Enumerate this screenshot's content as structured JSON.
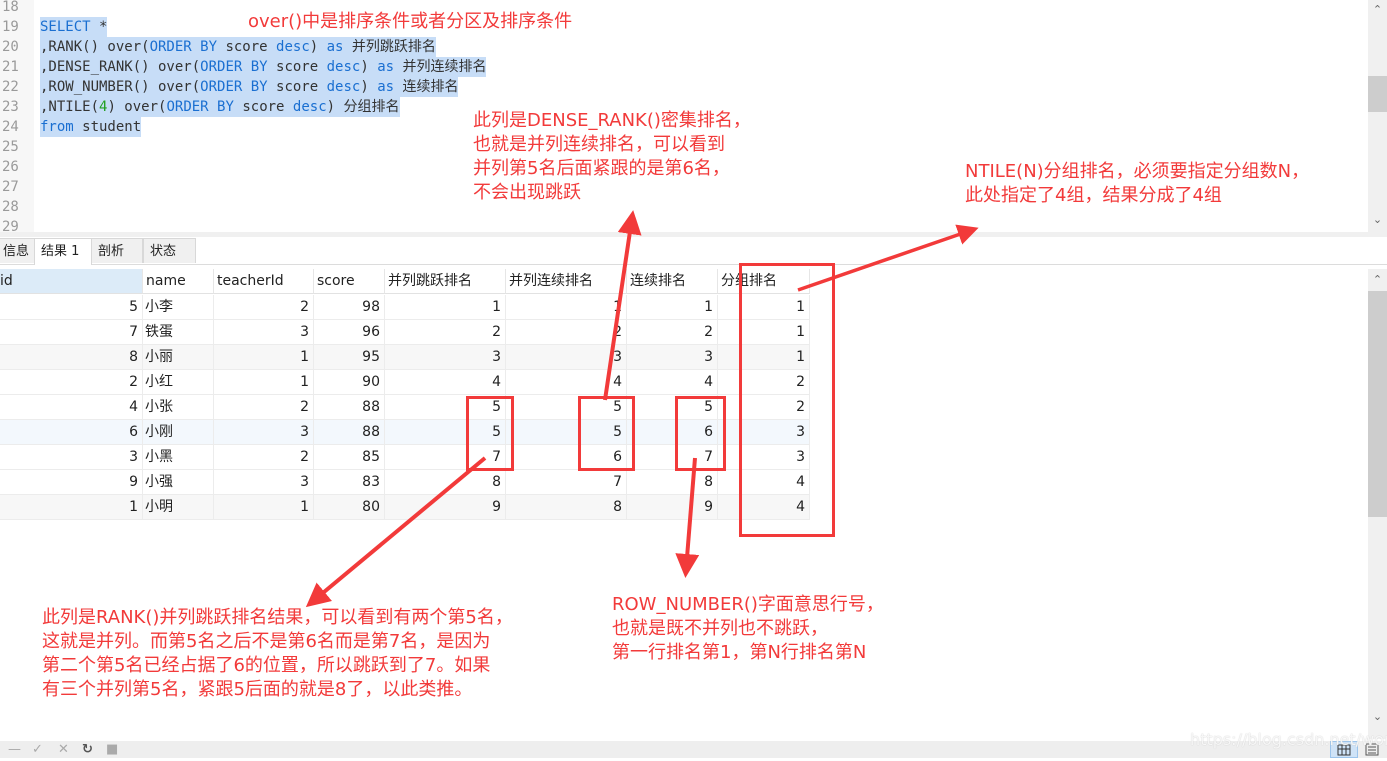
{
  "editor": {
    "lines": [
      {
        "n": "18",
        "tokens": []
      },
      {
        "n": "19",
        "tokens": [
          {
            "t": "SELECT",
            "c": "kw"
          },
          {
            "t": " *",
            "c": ""
          }
        ]
      },
      {
        "n": "20",
        "tokens": [
          {
            "t": ",RANK() over(",
            "c": ""
          },
          {
            "t": "ORDER BY",
            "c": "kw"
          },
          {
            "t": " score ",
            "c": ""
          },
          {
            "t": "desc",
            "c": "kw"
          },
          {
            "t": ") ",
            "c": ""
          },
          {
            "t": "as",
            "c": "kw"
          },
          {
            "t": " 并列跳跃排名",
            "c": ""
          }
        ]
      },
      {
        "n": "21",
        "tokens": [
          {
            "t": ",DENSE_RANK() over(",
            "c": ""
          },
          {
            "t": "ORDER BY",
            "c": "kw"
          },
          {
            "t": " score ",
            "c": ""
          },
          {
            "t": "desc",
            "c": "kw"
          },
          {
            "t": ") ",
            "c": ""
          },
          {
            "t": "as",
            "c": "kw"
          },
          {
            "t": " 并列连续排名",
            "c": ""
          }
        ]
      },
      {
        "n": "22",
        "tokens": [
          {
            "t": ",ROW_NUMBER() over(",
            "c": ""
          },
          {
            "t": "ORDER BY",
            "c": "kw"
          },
          {
            "t": " score ",
            "c": ""
          },
          {
            "t": "desc",
            "c": "kw"
          },
          {
            "t": ") ",
            "c": ""
          },
          {
            "t": "as",
            "c": "kw"
          },
          {
            "t": " 连续排名",
            "c": ""
          }
        ]
      },
      {
        "n": "23",
        "tokens": [
          {
            "t": ",NTILE(",
            "c": ""
          },
          {
            "t": "4",
            "c": "num"
          },
          {
            "t": ") over(",
            "c": ""
          },
          {
            "t": "ORDER BY",
            "c": "kw"
          },
          {
            "t": " score ",
            "c": ""
          },
          {
            "t": "desc",
            "c": "kw"
          },
          {
            "t": ") 分组排名",
            "c": ""
          }
        ]
      },
      {
        "n": "24",
        "tokens": [
          {
            "t": "from",
            "c": "kw"
          },
          {
            "t": " student",
            "c": ""
          }
        ]
      },
      {
        "n": "25",
        "tokens": []
      },
      {
        "n": "26",
        "tokens": []
      },
      {
        "n": "27",
        "tokens": []
      },
      {
        "n": "28",
        "tokens": []
      },
      {
        "n": "29",
        "tokens": []
      }
    ]
  },
  "tabs": [
    {
      "label": "信息",
      "active": false
    },
    {
      "label": "结果 1",
      "active": true
    },
    {
      "label": "剖析",
      "active": false
    },
    {
      "label": "状态",
      "active": false
    }
  ],
  "grid": {
    "columns": [
      "id",
      "name",
      "teacherId",
      "score",
      "并列跳跃排名",
      "并列连续排名",
      "连续排名",
      "分组排名"
    ],
    "rows": [
      [
        "5",
        "小李",
        "2",
        "98",
        "1",
        "1",
        "1",
        "1"
      ],
      [
        "7",
        "铁蛋",
        "3",
        "96",
        "2",
        "2",
        "2",
        "1"
      ],
      [
        "8",
        "小丽",
        "1",
        "95",
        "3",
        "3",
        "3",
        "1"
      ],
      [
        "2",
        "小红",
        "1",
        "90",
        "4",
        "4",
        "4",
        "2"
      ],
      [
        "4",
        "小张",
        "2",
        "88",
        "5",
        "5",
        "5",
        "2"
      ],
      [
        "6",
        "小刚",
        "3",
        "88",
        "5",
        "5",
        "6",
        "3"
      ],
      [
        "3",
        "小黑",
        "2",
        "85",
        "7",
        "6",
        "7",
        "3"
      ],
      [
        "9",
        "小强",
        "3",
        "83",
        "8",
        "7",
        "8",
        "4"
      ],
      [
        "1",
        "小明",
        "1",
        "80",
        "9",
        "8",
        "9",
        "4"
      ]
    ]
  },
  "annotations": {
    "over_note": "over()中是排序条件或者分区及排序条件",
    "dense_rank_note": [
      "此列是DENSE_RANK()密集排名，",
      "也就是并列连续排名，可以看到",
      "并列第5名后面紧跟的是第6名，",
      "不会出现跳跃"
    ],
    "ntile_note": [
      "NTILE(N)分组排名，必须要指定分组数N，",
      "此处指定了4组，结果分成了4组"
    ],
    "rank_note": [
      "此列是RANK()并列跳跃排名结果，可以看到有两个第5名，",
      "这就是并列。而第5名之后不是第6名而是第7名，是因为",
      "第二个第5名已经占据了6的位置，所以跳跃到了7。如果",
      "有三个并列第5名，紧跟5后面的就是8了，以此类推。"
    ],
    "row_number_note": [
      "ROW_NUMBER()字面意思行号，",
      "也就是既不并列也不跳跃，",
      "第一行排名第1，第N行排名第N"
    ]
  },
  "footer": {
    "watermark": "https://blog.csdn.net/worilb"
  },
  "colors": {
    "annotation_red": "#f23a3a",
    "selection_blue": "#c7ddf7",
    "keyword_blue": "#1a6fd1"
  }
}
